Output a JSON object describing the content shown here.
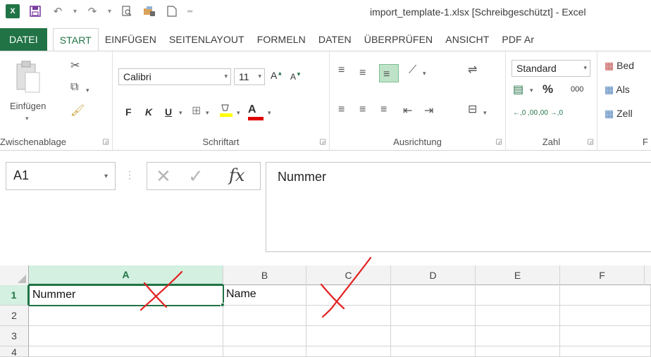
{
  "window": {
    "title": "import_template-1.xlsx  [Schreibgeschützt] - Excel",
    "app_badge": "X"
  },
  "ribbon_tabs": [
    {
      "label": "DATEI"
    },
    {
      "label": "START"
    },
    {
      "label": "EINFÜGEN"
    },
    {
      "label": "SEITENLAYOUT"
    },
    {
      "label": "FORMELN"
    },
    {
      "label": "DATEN"
    },
    {
      "label": "ÜBERPRÜFEN"
    },
    {
      "label": "ANSICHT"
    },
    {
      "label": "PDF Ar"
    }
  ],
  "ribbon": {
    "clipboard": {
      "paste_label": "Einfügen",
      "group_label": "Zwischenablage"
    },
    "font": {
      "font_name": "Calibri",
      "font_size": "11",
      "bold": "F",
      "italic": "K",
      "underline": "U",
      "grow": "A",
      "shrink": "A",
      "font_color": "A",
      "group_label": "Schriftart"
    },
    "alignment": {
      "group_label": "Ausrichtung"
    },
    "number": {
      "format": "Standard",
      "percent": "%",
      "thousands": "000",
      "inc_decimal": "←,0 ,00",
      "dec_decimal": ",00 →,0",
      "group_label": "Zahl"
    },
    "styles": {
      "item1": "Bed",
      "item2": "Als",
      "item3": "Zell",
      "group_label": "F"
    }
  },
  "formula_bar": {
    "name_box": "A1",
    "fx_label": "fx",
    "content": "Nummer"
  },
  "grid": {
    "columns": [
      "A",
      "B",
      "C",
      "D",
      "E",
      "F"
    ],
    "selected_column": "A",
    "rows": [
      {
        "number": "1",
        "cells": [
          "Nummer",
          "Name",
          "",
          "",
          "",
          ""
        ]
      },
      {
        "number": "2",
        "cells": [
          "",
          "",
          "",
          "",
          "",
          ""
        ]
      },
      {
        "number": "3",
        "cells": [
          "",
          "",
          "",
          "",
          "",
          ""
        ]
      },
      {
        "number": "4",
        "cells": [
          "",
          "",
          "",
          "",
          "",
          ""
        ]
      }
    ],
    "active_cell": "A1"
  },
  "colors": {
    "accent": "#217346",
    "annotation": "#e32222"
  },
  "icons": [
    "excel-logo",
    "save-icon",
    "undo-icon",
    "redo-icon",
    "print-preview-icon",
    "touch-mode-icon",
    "new-file-icon",
    "customize-icon"
  ]
}
